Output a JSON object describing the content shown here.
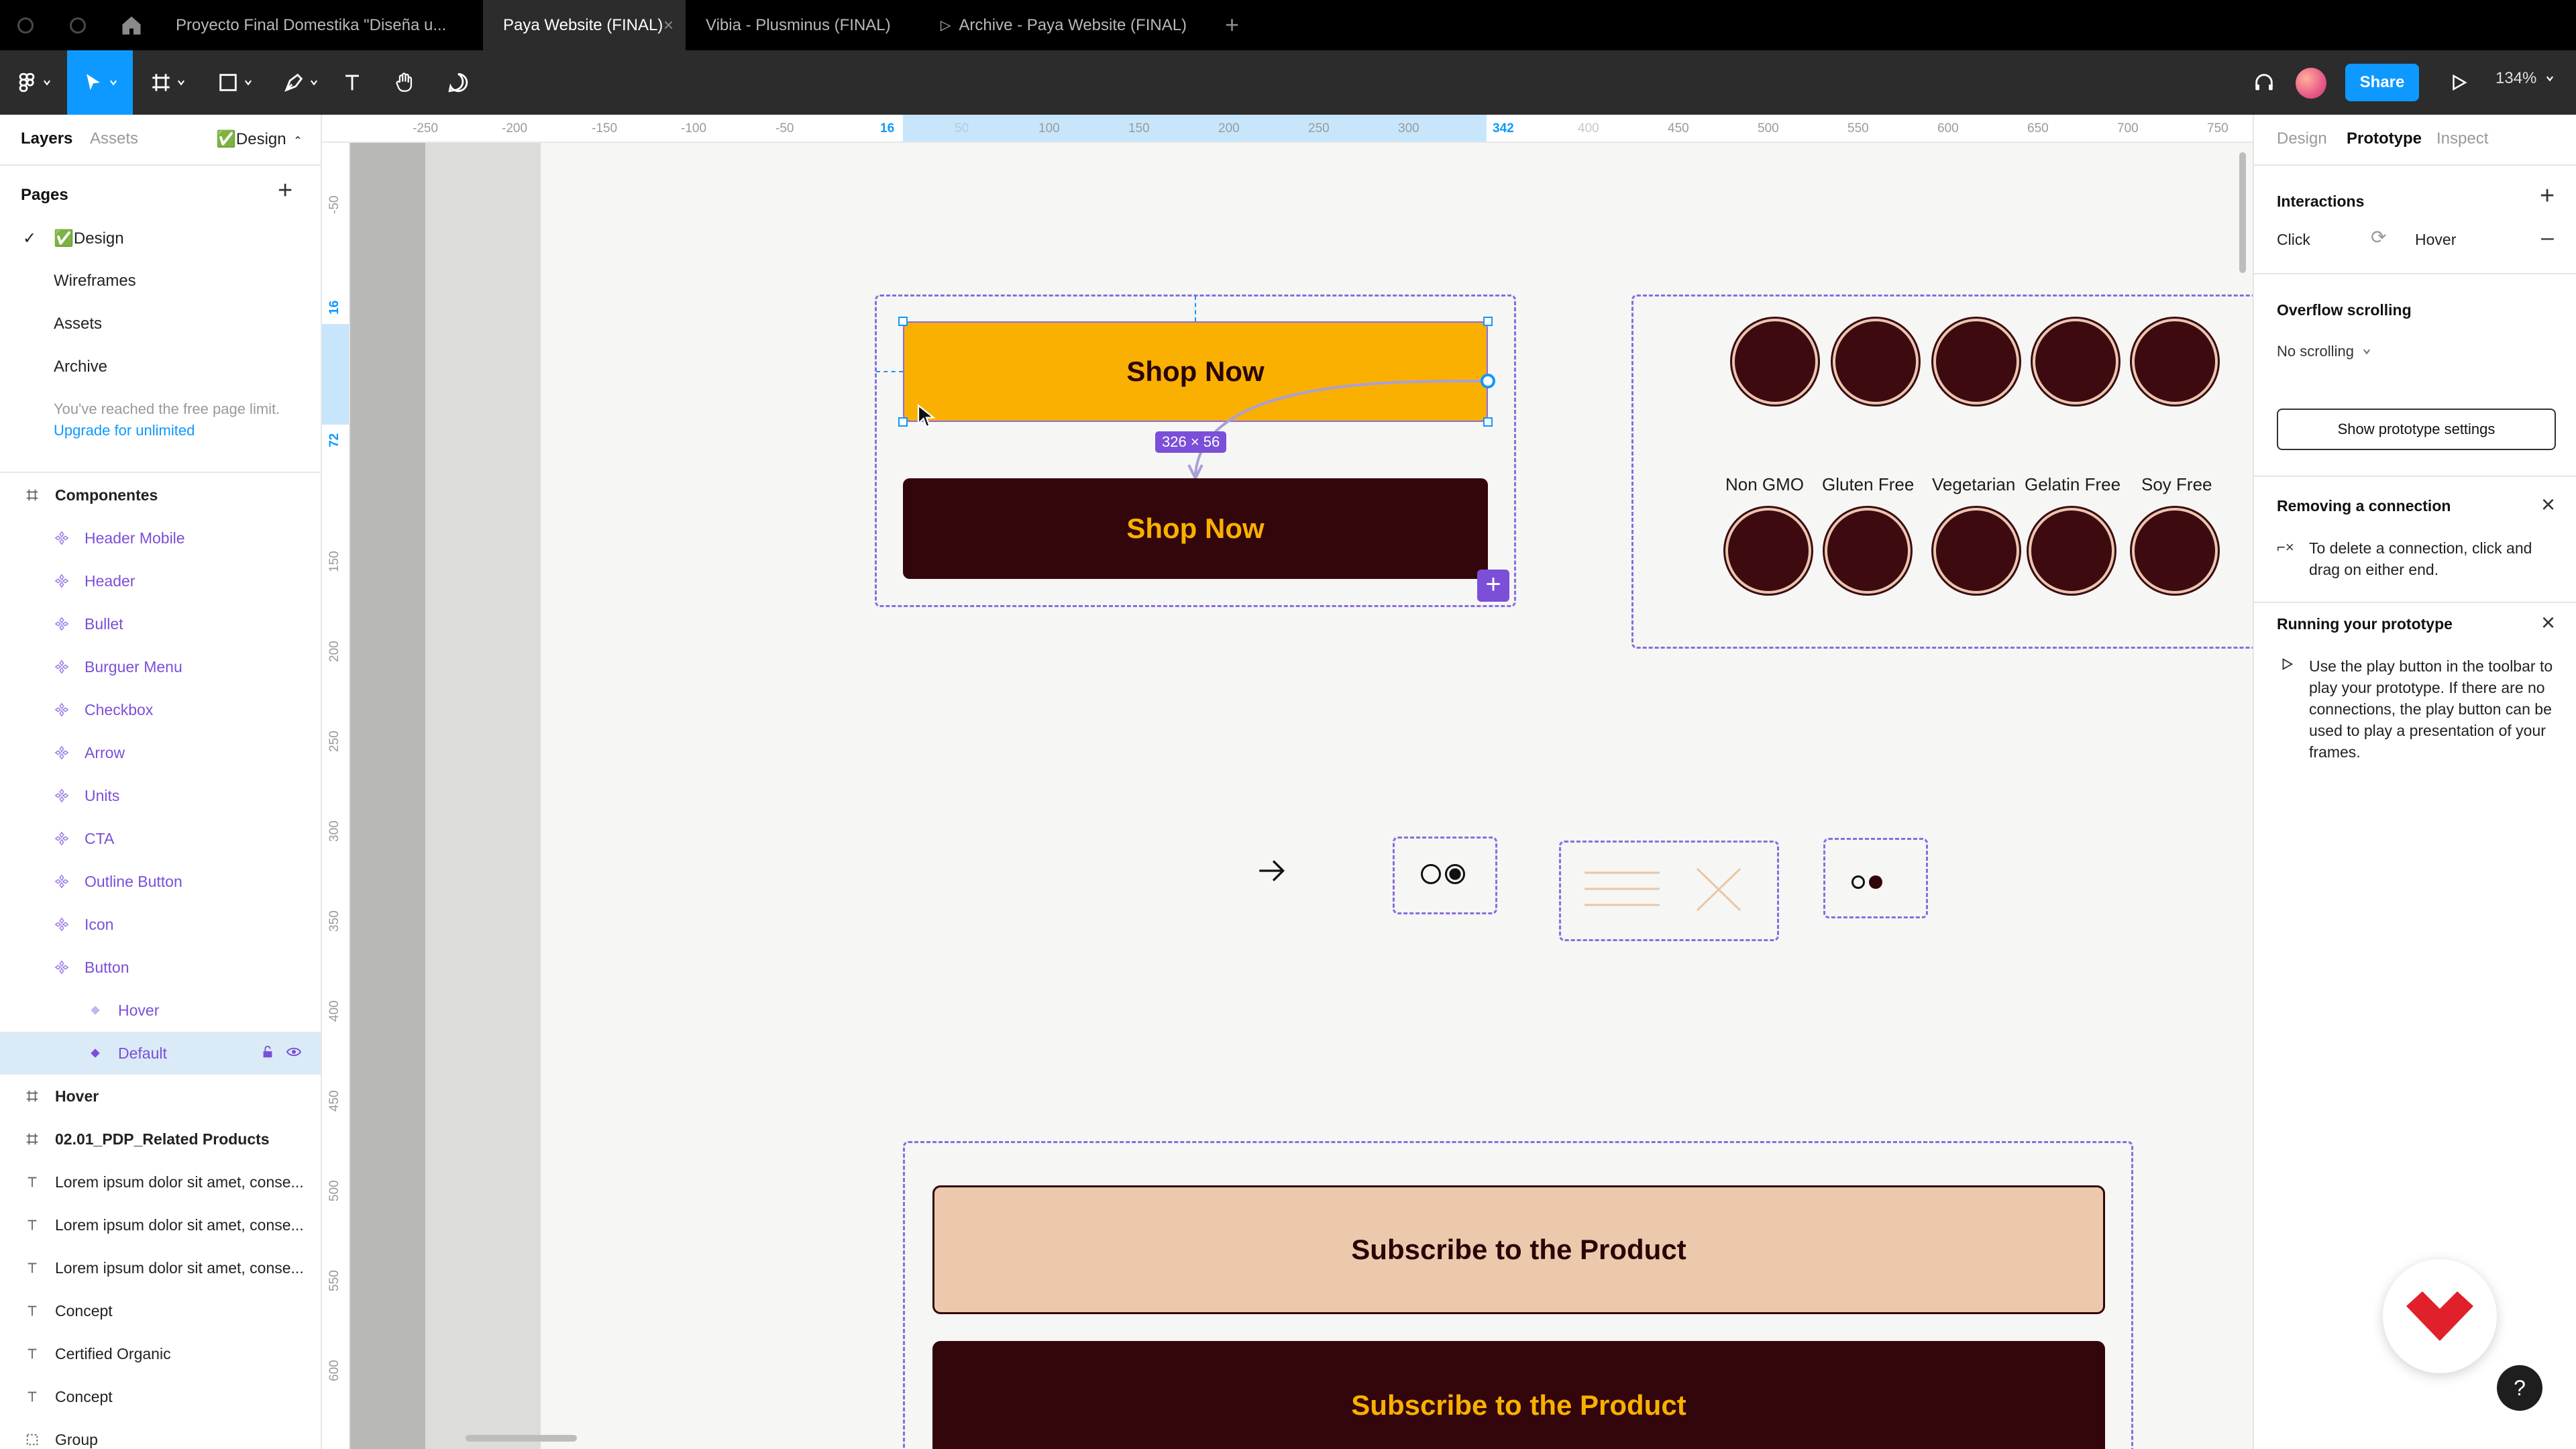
{
  "tabs": [
    {
      "label": "Proyecto Final Domestika \"Diseña u...",
      "active": false
    },
    {
      "label": "Paya Website (FINAL)",
      "active": true
    },
    {
      "label": "Vibia - Plusminus (FINAL)",
      "active": false
    },
    {
      "label": "Archive - Paya Website (FINAL)",
      "active": false
    }
  ],
  "toolbar": {
    "share_label": "Share",
    "zoom": "134%"
  },
  "left_panel": {
    "tab_layers": "Layers",
    "tab_assets": "Assets",
    "page_switcher": "✅Design",
    "pages_title": "Pages",
    "pages": [
      "✅Design",
      "Wireframes",
      "Assets",
      "Archive"
    ],
    "limit_note": "You've reached the free page limit.",
    "upgrade_link": "Upgrade for unlimited",
    "layers": [
      {
        "label": "Componentes",
        "kind": "frame"
      },
      {
        "label": "Header Mobile",
        "kind": "component"
      },
      {
        "label": "Header",
        "kind": "component"
      },
      {
        "label": "Bullet",
        "kind": "component"
      },
      {
        "label": "Burguer Menu",
        "kind": "component"
      },
      {
        "label": "Checkbox",
        "kind": "component"
      },
      {
        "label": "Arrow",
        "kind": "component"
      },
      {
        "label": "Units",
        "kind": "component"
      },
      {
        "label": "CTA",
        "kind": "component"
      },
      {
        "label": "Outline Button",
        "kind": "component"
      },
      {
        "label": "Icon",
        "kind": "component"
      },
      {
        "label": "Button",
        "kind": "component"
      },
      {
        "label": "Hover",
        "kind": "variant"
      },
      {
        "label": "Default",
        "kind": "variant-selected"
      },
      {
        "label": "Hover",
        "kind": "frame"
      },
      {
        "label": "02.01_PDP_Related Products",
        "kind": "frame"
      },
      {
        "label": "Lorem ipsum dolor sit amet, conse...",
        "kind": "text"
      },
      {
        "label": "Lorem ipsum dolor sit amet, conse...",
        "kind": "text"
      },
      {
        "label": "Lorem ipsum dolor sit amet, conse...",
        "kind": "text"
      },
      {
        "label": "Concept",
        "kind": "text"
      },
      {
        "label": "Certified Organic",
        "kind": "text"
      },
      {
        "label": "Concept",
        "kind": "text"
      },
      {
        "label": "Group",
        "kind": "group"
      }
    ]
  },
  "rulers": {
    "h_ticks": [
      "-250",
      "-200",
      "-150",
      "-100",
      "-50",
      "16",
      "50",
      "100",
      "150",
      "200",
      "250",
      "300",
      "342",
      "400",
      "450",
      "500",
      "550",
      "600",
      "650",
      "700",
      "750"
    ],
    "v_ticks": [
      "-50",
      "16",
      "72",
      "150",
      "200",
      "250",
      "300",
      "350",
      "400",
      "450",
      "500",
      "550",
      "600"
    ]
  },
  "canvas": {
    "button_default_label": "Shop Now",
    "button_hover_label": "Shop Now",
    "size_badge": "326 × 56",
    "badges_labels": [
      "Non GMO",
      "Gluten Free",
      "Vegetarian",
      "Gelatin Free",
      "Soy Free"
    ],
    "subscribe_light": "Subscribe to the Product",
    "subscribe_dark": "Subscribe to the Product"
  },
  "right_panel": {
    "tab_design": "Design",
    "tab_prototype": "Prototype",
    "tab_inspect": "Inspect",
    "interactions_title": "Interactions",
    "interaction_trigger": "Click",
    "interaction_target": "Hover",
    "overflow_title": "Overflow scrolling",
    "overflow_value": "No scrolling",
    "prototype_settings_button": "Show prototype settings",
    "removing_title": "Removing a connection",
    "removing_text": "To delete a connection, click and drag on either end.",
    "running_title": "Running your prototype",
    "running_text": "Use the play button in the toolbar to play your prototype. If there are no connections, the play button can be used to play a presentation of your frames."
  },
  "colors": {
    "accent": "#0d99ff",
    "component_purple": "#7b4fd8",
    "button_yellow": "#f9b000",
    "button_maroon": "#33060b",
    "subscribe_peach": "#ecc9ad",
    "domestika_red": "#e0202b"
  },
  "help_label": "?"
}
